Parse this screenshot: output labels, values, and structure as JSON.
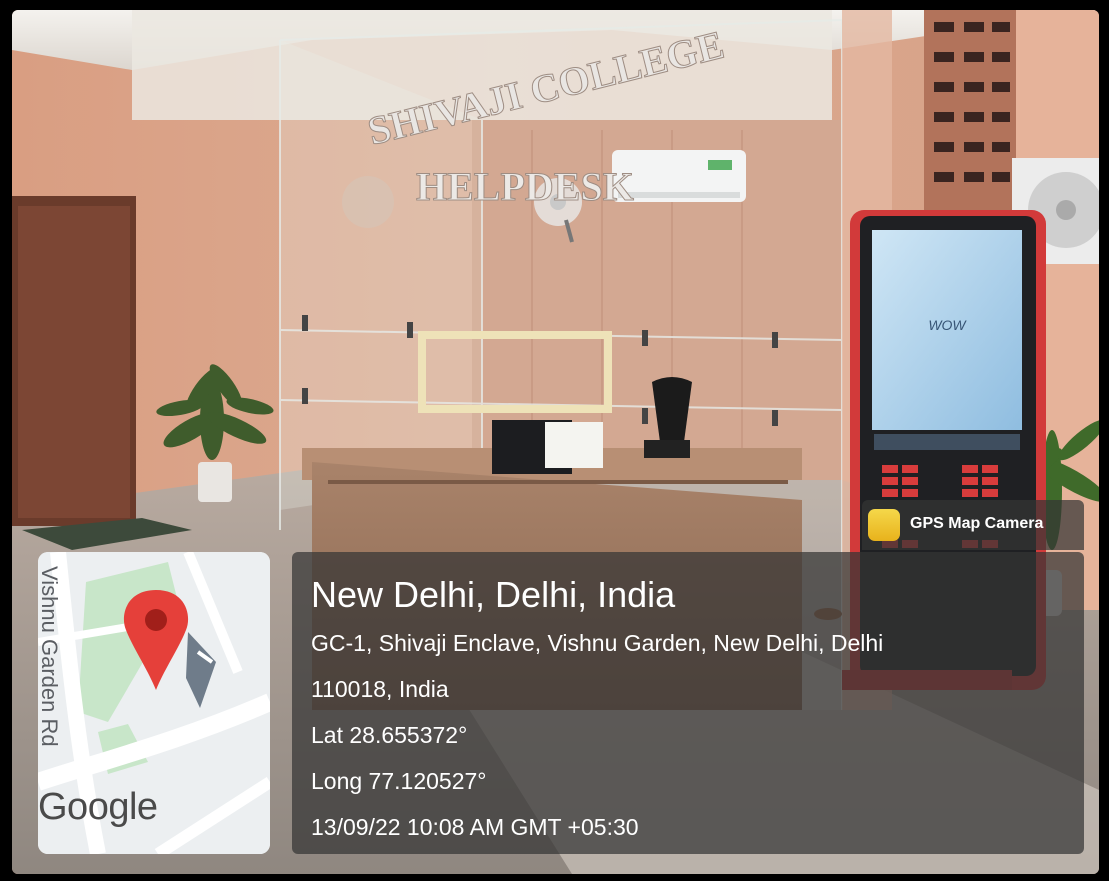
{
  "photo": {
    "sign_line1": "SHIVAJI COLLEGE",
    "sign_line2": "HELPDESK",
    "kiosk_brand": "WOW"
  },
  "overlay": {
    "app_name": "GPS Map Camera",
    "map": {
      "road_label": "Vishnu Garden Rd",
      "brand": "Google"
    },
    "location_title": "New Delhi, Delhi, India",
    "address_line1": "GC-1, Shivaji Enclave, Vishnu Garden, New Delhi, Delhi",
    "address_line2": "110018, India",
    "latitude": "Lat 28.655372°",
    "longitude": "Long 77.120527°",
    "timestamp": "13/09/22 10:08 AM GMT +05:30"
  },
  "colors": {
    "wall": "#d9a48a",
    "pin": "#e5403a",
    "kiosk_frame": "#d23a3a"
  }
}
